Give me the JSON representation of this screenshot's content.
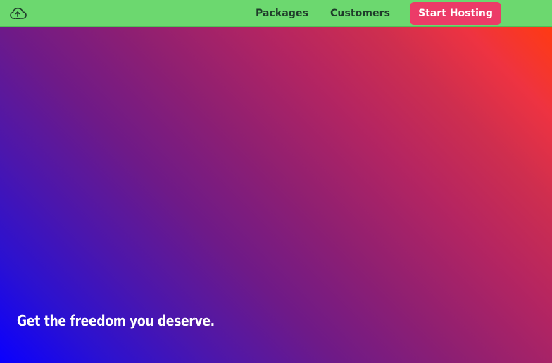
{
  "header": {
    "logo": {
      "icon": "cloud-upload-logo-icon",
      "alt": ""
    },
    "nav": {
      "packages_label": "Packages",
      "customers_label": "Customers"
    },
    "cta_label": "Start Hosting",
    "colors": {
      "header_bg": "#6cd86f",
      "nav_text": "#1f3b2a",
      "cta_bg": "#ec3b68",
      "cta_text": "#ffffff"
    }
  },
  "hero": {
    "tagline": "Get the freedom you deserve.",
    "colors": {
      "gradient_top_right": "#ff3a12",
      "gradient_mid": "#8e1f72",
      "gradient_bottom_left": "#0a00ff",
      "text": "#ffffff"
    }
  }
}
